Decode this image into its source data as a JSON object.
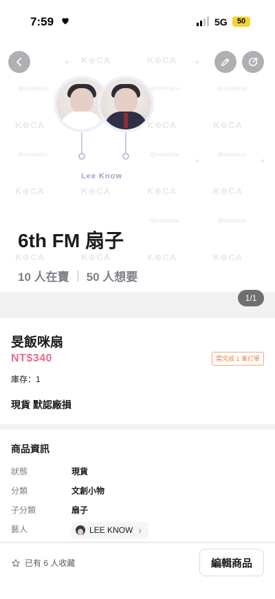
{
  "status_bar": {
    "time": "7:59",
    "network": "5G",
    "battery": "50"
  },
  "hero": {
    "watermark": "K⊕CA",
    "watermark_handle": "@minkhaza",
    "fan_caption": "Lee Know",
    "title": "6th FM 扇子",
    "selling": "10 人在賣",
    "wanting": "50 人想要",
    "image_counter": "1/1"
  },
  "product": {
    "name": "旻飯咪扇",
    "price": "NT$340",
    "order_badge": "需完成 1 筆訂單",
    "stock": "庫存：1",
    "tags": "現貨 默認廠損"
  },
  "info": {
    "title": "商品資訊",
    "rows": [
      {
        "key": "狀態",
        "value": "現貨"
      },
      {
        "key": "分類",
        "value": "文創小物"
      },
      {
        "key": "子分類",
        "value": "扇子"
      }
    ],
    "artist_key": "藝人",
    "artist_name": "LEE KNOW"
  },
  "bottom": {
    "favorites": "已有 6 人收藏",
    "edit_label": "編輯商品"
  },
  "colors": {
    "price": "#ea6b8b",
    "badge": "#e9844e",
    "battery": "#f5d330"
  }
}
